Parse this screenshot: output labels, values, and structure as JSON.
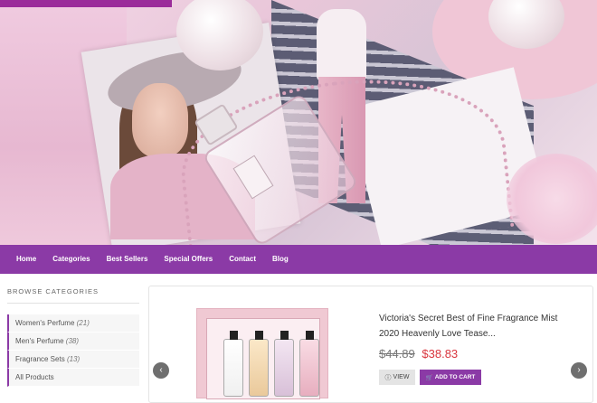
{
  "nav": {
    "items": [
      "Home",
      "Categories",
      "Best Sellers",
      "Special Offers",
      "Contact",
      "Blog"
    ]
  },
  "sidebar": {
    "title": "BROWSE CATEGORIES",
    "items": [
      {
        "label": "Women's Perfume",
        "count": "(21)"
      },
      {
        "label": "Men's Perfume",
        "count": "(38)"
      },
      {
        "label": "Fragrance Sets",
        "count": "(13)"
      },
      {
        "label": "All Products",
        "count": ""
      }
    ]
  },
  "product": {
    "title": "Victoria's Secret Best of Fine Fragrance Mist 2020 Heavenly Love Tease...",
    "old_price": "$44.89",
    "new_price": "$38.83",
    "view_label": "VIEW",
    "cart_label": "ADD TO CART",
    "view_icon": "info-icon",
    "cart_icon": "cart-icon"
  },
  "carousel": {
    "prev_icon": "chevron-left-icon",
    "next_icon": "chevron-right-icon"
  },
  "colors": {
    "accent": "#8b3aa6",
    "sale_price": "#d9363e"
  }
}
